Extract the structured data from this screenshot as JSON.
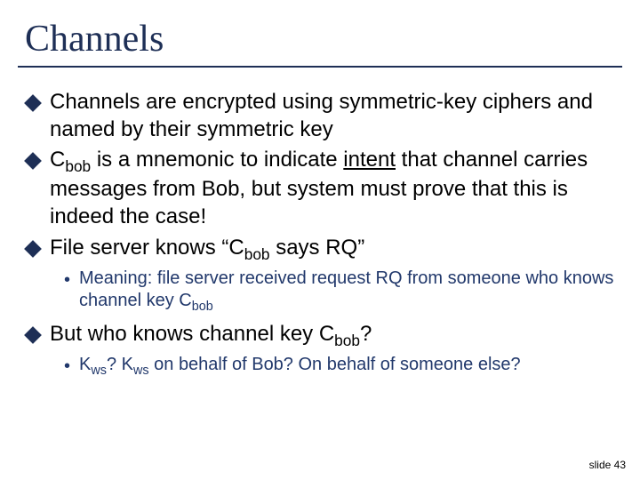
{
  "title": "Channels",
  "bullets": {
    "b1": "Channels are encrypted using symmetric-key ciphers and named by their symmetric key",
    "b2_pre": "C",
    "b2_sub": "bob",
    "b2_mid": " is a mnemonic to indicate ",
    "b2_u": "intent",
    "b2_post": " that channel carries messages from Bob, but system must prove that this is indeed the case!",
    "b3_pre": "File server knows “C",
    "b3_sub": "bob",
    "b3_post": " says RQ”",
    "b4_pre": "But who knows channel key C",
    "b4_sub": "bob",
    "b4_post": "?"
  },
  "subs": {
    "s1_pre": "Meaning: file server received request RQ from someone who knows channel key C",
    "s1_sub": "bob",
    "s2_a": "K",
    "s2_sub1": "ws",
    "s2_b": "? K",
    "s2_sub2": "ws",
    "s2_c": " on behalf of Bob? On behalf of someone else?"
  },
  "footer": "slide 43"
}
